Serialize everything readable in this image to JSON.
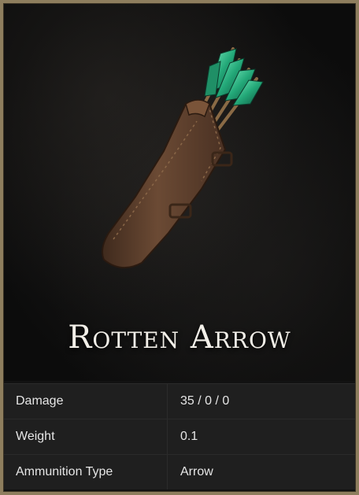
{
  "item": {
    "name": "Rotten Arrow",
    "icon": "quiver-with-arrows-image"
  },
  "stats": [
    {
      "label": "Damage",
      "value": "35 / 0 / 0"
    },
    {
      "label": "Weight",
      "value": "0.1"
    },
    {
      "label": "Ammunition Type",
      "value": "Arrow"
    }
  ],
  "colors": {
    "frame": "#8e7e5e",
    "background": "#121212",
    "fletching": "#2fbf8a",
    "leather": "#6b4a34"
  }
}
